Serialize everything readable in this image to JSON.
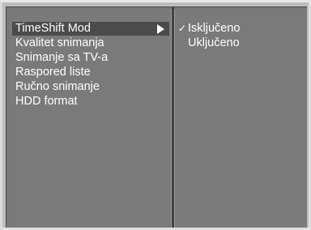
{
  "menu": {
    "items": [
      {
        "label": "TimeShift Mod",
        "selected": true,
        "has_submenu": true
      },
      {
        "label": "Kvalitet snimanja"
      },
      {
        "label": "Snimanje sa TV-a"
      },
      {
        "label": "Raspored liste"
      },
      {
        "label": "Ručno snimanje"
      },
      {
        "label": "HDD format"
      }
    ]
  },
  "submenu": {
    "options": [
      {
        "label": "Isključeno",
        "checked": true,
        "check_mark": "✓"
      },
      {
        "label": "Uključeno",
        "checked": false,
        "check_mark": ""
      }
    ]
  },
  "colors": {
    "panel_bg": "#7a7a7a",
    "selected_bg": "#4b4b4b",
    "text": "#ffffff",
    "bezel": "#bdbdbd"
  }
}
